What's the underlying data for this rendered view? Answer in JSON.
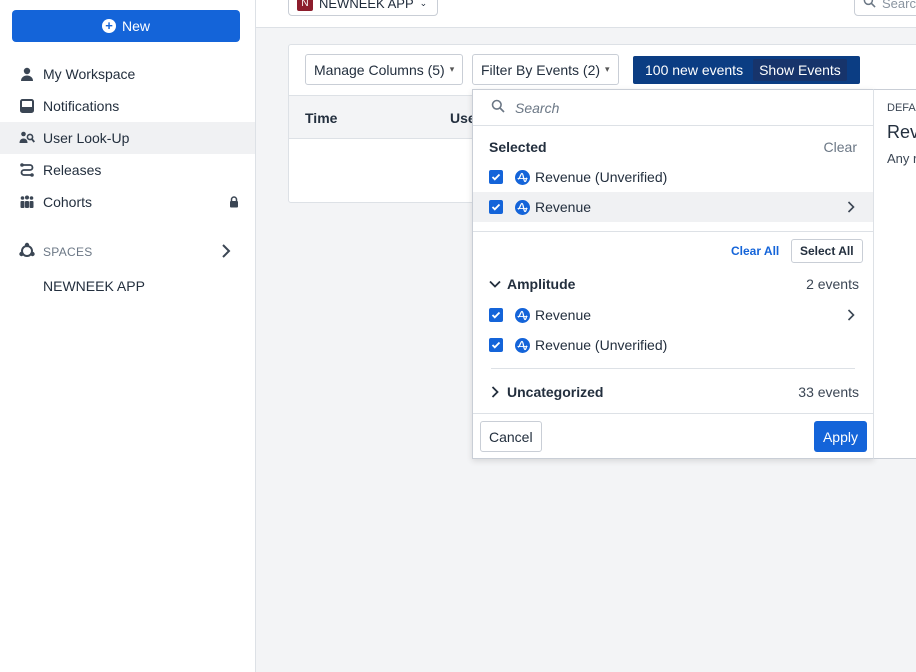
{
  "sidebar": {
    "new_label": "New",
    "items": [
      {
        "label": "My Workspace",
        "icon": "person-icon"
      },
      {
        "label": "Notifications",
        "icon": "inbox-icon"
      },
      {
        "label": "User Look-Up",
        "icon": "user-search-icon",
        "active": true
      },
      {
        "label": "Releases",
        "icon": "releases-icon"
      },
      {
        "label": "Cohorts",
        "icon": "cohorts-icon",
        "locked": true
      }
    ],
    "spaces_label": "SPACES",
    "space_items": [
      "NEWNEEK APP"
    ]
  },
  "topbar": {
    "app_badge": "N",
    "app_name": "NEWNEEK APP",
    "search_placeholder": "Search"
  },
  "toolbar": {
    "manage_columns": "Manage Columns (5)",
    "filter_events": "Filter By Events (2)",
    "new_events": "100 new events",
    "show_events": "Show Events"
  },
  "table": {
    "columns": [
      "Time",
      "User"
    ]
  },
  "dropdown": {
    "search_placeholder": "Search",
    "selected_title": "Selected",
    "clear_label": "Clear",
    "selected_items": [
      "Revenue (Unverified)",
      "Revenue"
    ],
    "clear_all": "Clear All",
    "select_all": "Select All",
    "groups": [
      {
        "name": "Amplitude",
        "count": "2 events",
        "expanded": true,
        "items": [
          "Revenue",
          "Revenue (Unverified)"
        ]
      },
      {
        "name": "Uncategorized",
        "count": "33 events",
        "expanded": false
      }
    ],
    "cancel": "Cancel",
    "apply": "Apply"
  },
  "detail": {
    "kicker": "DEFAULT",
    "title": "Revenue",
    "desc": "Any revenue"
  },
  "colors": {
    "primary": "#1464d9",
    "banner": "#0b3d83",
    "app_badge": "#8c1c2c"
  }
}
